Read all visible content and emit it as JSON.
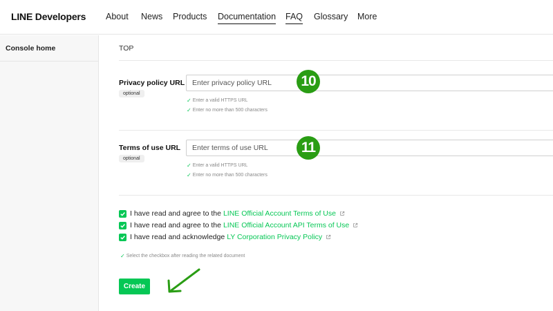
{
  "header": {
    "logo": "LINE Developers",
    "nav": [
      {
        "label": "About"
      },
      {
        "label": "News"
      },
      {
        "label": "Products"
      },
      {
        "label": "Documentation"
      },
      {
        "label": "FAQ"
      },
      {
        "label": "Glossary"
      },
      {
        "label": "More"
      }
    ]
  },
  "sidebar": {
    "items": [
      {
        "label": "Console home"
      }
    ]
  },
  "main": {
    "breadcrumb": "TOP",
    "privacy": {
      "label": "Privacy policy URL",
      "optional": "optional",
      "placeholder": "Enter privacy policy URL",
      "hints": [
        "Enter a valid HTTPS URL",
        "Enter no more than 500 characters"
      ],
      "annotation": "10"
    },
    "terms": {
      "label": "Terms of use URL",
      "optional": "optional",
      "placeholder": "Enter terms of use URL",
      "hints": [
        "Enter a valid HTTPS URL",
        "Enter no more than 500 characters"
      ],
      "annotation": "11"
    },
    "agreements": [
      {
        "prefix": "I have read and agree to the",
        "link": "LINE Official Account Terms of Use",
        "checked": true
      },
      {
        "prefix": "I have read and agree to the",
        "link": "LINE Official Account API Terms of Use",
        "checked": true
      },
      {
        "prefix": "I have read and acknowledge",
        "link": "LY Corporation Privacy Policy",
        "checked": true
      }
    ],
    "select_hint": "Select the checkbox after reading the related document",
    "create_label": "Create"
  },
  "colors": {
    "brand_green": "#06c755",
    "annotation_green": "#2a9d14"
  },
  "icons": {
    "check": "check-icon",
    "external": "external-link-icon",
    "arrow": "arrow-icon"
  }
}
